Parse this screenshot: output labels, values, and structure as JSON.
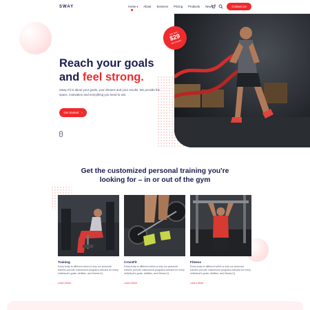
{
  "header": {
    "logo": "SWAY",
    "nav": [
      "Home",
      "About",
      "Services",
      "Pricing",
      "Products",
      "News"
    ],
    "contact_label": "Contact Us"
  },
  "hero": {
    "title_line1": "Reach your goals",
    "title_line2_prefix": "and ",
    "title_line2_accent": "feel strong.",
    "description": "Sway Fit is about your goals, your dreams and your results. We provide the space, motivation and everything you need to win.",
    "cta_label": "Get Started",
    "cta_arrow": "›",
    "badge": {
      "top": "only from",
      "price": "$29",
      "bottom": "per session"
    }
  },
  "section": {
    "title": "Get the customized personal training you're looking for – in or out of the gym",
    "cards": [
      {
        "title": "Training",
        "text": "Every body is different which is why our personal trainers provide customized programs tailored for every individual's goals, abilities, and fitness IQ.",
        "link": "Learn More"
      },
      {
        "title": "CrossFit",
        "text": "Every body is different which is why our personal trainers provide customized programs tailored for every individual's goals, abilities, and fitness IQ.",
        "link": "Learn More"
      },
      {
        "title": "Fitness",
        "text": "Every body is different which is why our personal trainers provide customized programs tailored for every individual's goals, abilities, and fitness IQ.",
        "link": "Learn More"
      }
    ]
  },
  "colors": {
    "accent": "#ef2b2d",
    "navy": "#1b1d4f",
    "muted": "#5a5d77",
    "pink_bg": "#fff1f1"
  },
  "icons": {
    "cart": "cart-icon",
    "search": "search-icon",
    "scroll": "scroll-mouse-icon",
    "caret": "chevron-down-icon"
  }
}
